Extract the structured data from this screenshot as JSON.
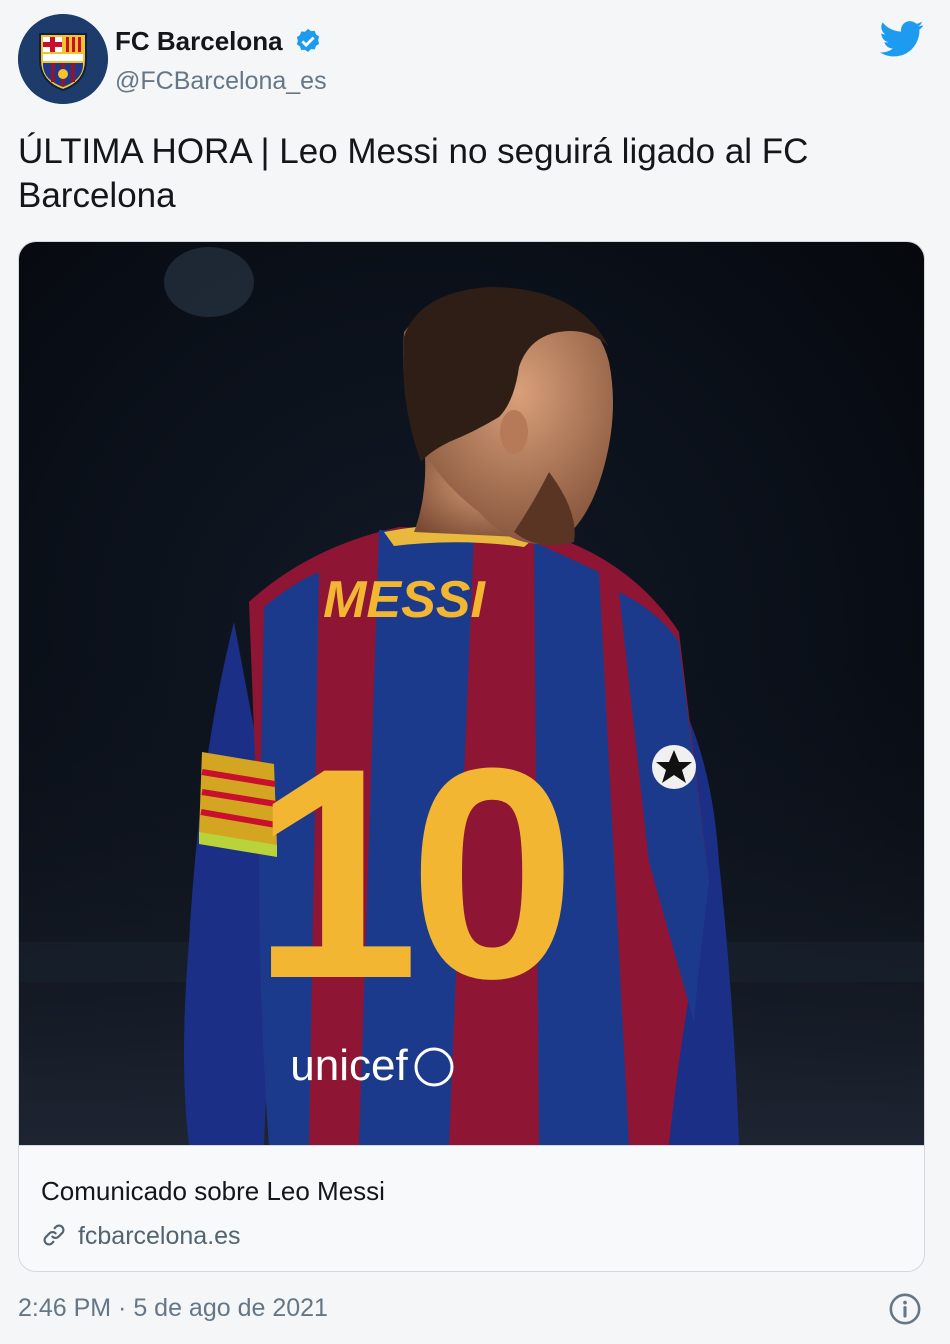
{
  "author": {
    "display_name": "FC Barcelona",
    "handle": "@FCBarcelona_es",
    "avatar_icon": "fc-barcelona-crest",
    "verified_icon": "verified-badge-icon"
  },
  "brand_icon": "twitter-bird-icon",
  "tweet": {
    "text": "ÚLTIMA HORA | Leo Messi no seguirá ligado al FC Barcelona"
  },
  "card": {
    "media": {
      "jersey_name": "MESSI",
      "jersey_number": "10",
      "sponsor": "unicef"
    },
    "title": "Comunicado sobre Leo Messi",
    "domain": "fcbarcelona.es",
    "link_icon": "link-icon"
  },
  "footer": {
    "timestamp": "2:46 PM · 5 de ago de 2021",
    "info_icon": "info-icon"
  },
  "colors": {
    "twitter_blue": "#1d9bf0",
    "barca_blue": "#1b3a8c",
    "barca_red": "#8e1634",
    "gold": "#f2b632"
  }
}
